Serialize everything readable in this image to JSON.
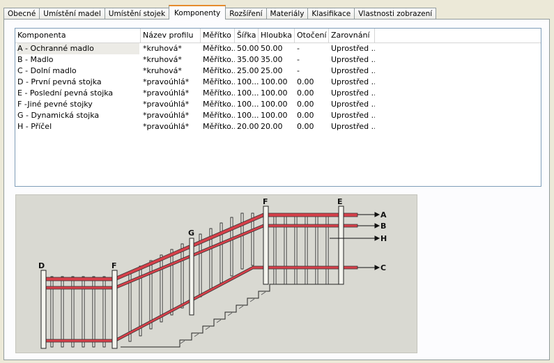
{
  "tabs": [
    {
      "label": "Obecné",
      "active": false
    },
    {
      "label": "Umístění madel",
      "active": false
    },
    {
      "label": "Umístění stojek",
      "active": false
    },
    {
      "label": "Komponenty",
      "active": true
    },
    {
      "label": "Rozšíření",
      "active": false
    },
    {
      "label": "Materiály",
      "active": false
    },
    {
      "label": "Klasifikace",
      "active": false
    },
    {
      "label": "Vlastnosti zobrazení",
      "active": false
    }
  ],
  "table": {
    "columns": [
      "Komponenta",
      "Název profilu",
      "Měřítko",
      "Šířka",
      "Hloubka",
      "Otočení",
      "Zarovnání"
    ],
    "rows": [
      [
        "A - Ochranné madlo",
        "*kruhová*",
        "Měřítko...",
        "50.00",
        "50.00",
        "-",
        "Uprostřed ..."
      ],
      [
        "B - Madlo",
        "*kruhová*",
        "Měřítko...",
        "35.00",
        "35.00",
        "-",
        "Uprostřed ..."
      ],
      [
        "C - Dolní madlo",
        "*kruhová*",
        "Měřítko...",
        "25.00",
        "25.00",
        "-",
        "Uprostřed ..."
      ],
      [
        "D - První pevná stojka",
        "*pravoúhlá*",
        "Měřítko...",
        "100...",
        "100.00",
        "0.00",
        "Uprostřed ..."
      ],
      [
        "E - Poslední pevná stojka",
        "*pravoúhlá*",
        "Měřítko...",
        "100...",
        "100.00",
        "0.00",
        "Uprostřed ..."
      ],
      [
        "F -Jiné pevné stojky",
        "*pravoúhlá*",
        "Měřítko...",
        "100...",
        "100.00",
        "0.00",
        "Uprostřed ..."
      ],
      [
        "G - Dynamická stojka",
        "*pravoúhlá*",
        "Měřítko...",
        "100...",
        "100.00",
        "0.00",
        "Uprostřed ..."
      ],
      [
        "H - Příčel",
        "*pravoúhlá*",
        "Měřítko...",
        "20.00",
        "20.00",
        "0.00",
        "Uprostřed ..."
      ]
    ]
  },
  "diagram": {
    "labels": {
      "A": "A",
      "B": "B",
      "C": "C",
      "D": "D",
      "E": "E",
      "F": "F",
      "G": "G",
      "H": "H"
    },
    "rail_color": "#d6404a",
    "background": "#d9d9d2"
  }
}
